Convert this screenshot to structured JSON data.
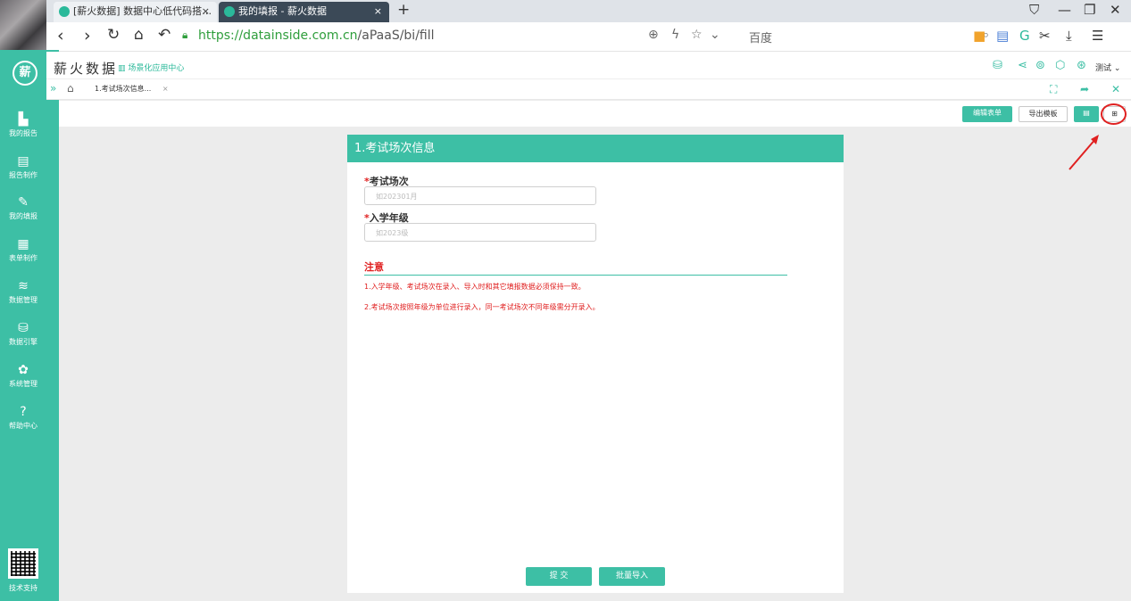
{
  "browser": {
    "tabs": [
      {
        "label": "[薪火数据] 数据中心低代码搭…",
        "close": "×"
      },
      {
        "label": "我的填报 - 薪火数据",
        "close": "×"
      }
    ],
    "new_tab": "+",
    "url_https": "https://datainside.com.cn",
    "url_rest": "/aPaaS/bi/fill",
    "search_placeholder": "百度"
  },
  "app": {
    "logo": "薪",
    "title": "薪火数据",
    "scene_link": "场景化应用中心",
    "username": "测试",
    "sidebar": [
      {
        "label": "我的报告",
        "icon": "▙"
      },
      {
        "label": "报告制作",
        "icon": "▤"
      },
      {
        "label": "我的填报",
        "icon": "✎"
      },
      {
        "label": "表单制作",
        "icon": "▦"
      },
      {
        "label": "数据管理",
        "icon": "≋"
      },
      {
        "label": "数据引擎",
        "icon": "⛁"
      },
      {
        "label": "系统管理",
        "icon": "✿"
      },
      {
        "label": "帮助中心",
        "icon": "?"
      }
    ],
    "support_label": "技术支持",
    "page_tab": "1.考试场次信息...",
    "page_tab_close": "×",
    "toolbar": {
      "edit_form": "编辑表单",
      "export_template": "导出模板"
    }
  },
  "form": {
    "title": "1.考试场次信息",
    "fields": [
      {
        "label": "考试场次",
        "required": "*",
        "placeholder": "如202301月"
      },
      {
        "label": "入学年级",
        "required": "*",
        "placeholder": "如2023级"
      }
    ],
    "note_title": "注意",
    "notes": [
      "1.入学年级、考试场次在录入、导入时和其它填报数据必须保持一致。",
      "2.考试场次按照年级为单位进行录入，同一考试场次不同年级需分开录入。"
    ],
    "submit": "提 交",
    "batch_import": "批量导入"
  },
  "colors": {
    "accent": "#3dbfa5",
    "warning": "#e02020"
  }
}
